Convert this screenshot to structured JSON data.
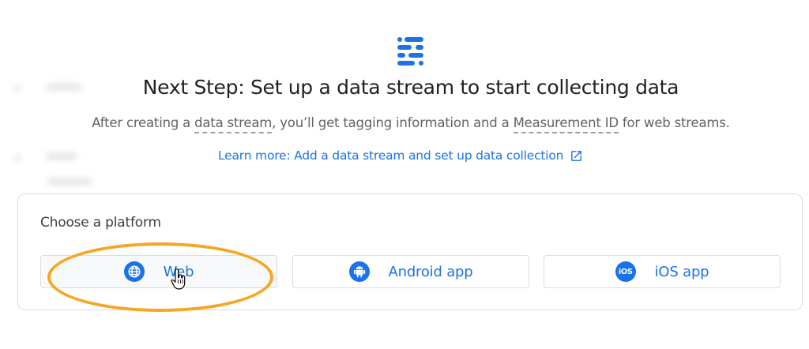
{
  "header": {
    "icon": "data-stream-icon",
    "headline": "Next Step: Set up a data stream to start collecting data",
    "subline_before": "After creating a ",
    "term1": "data stream",
    "subline_middle": ", you’ll get tagging information and a ",
    "term2": "Measurement ID",
    "subline_after": " for web streams.",
    "learn_more_label": "Learn more: Add a data stream and set up data collection",
    "learn_more_icon": "open-in-new-icon"
  },
  "platform_card": {
    "title": "Choose a platform",
    "buttons": [
      {
        "label": "Web",
        "icon": "globe-icon"
      },
      {
        "label": "Android app",
        "icon": "android-icon"
      },
      {
        "label": "iOS app",
        "icon": "ios-icon",
        "icon_text": "iOS"
      }
    ]
  },
  "colors": {
    "accent": "#1a73e8",
    "highlight": "#f5a623",
    "text": "#202124",
    "muted": "#5f6368"
  }
}
